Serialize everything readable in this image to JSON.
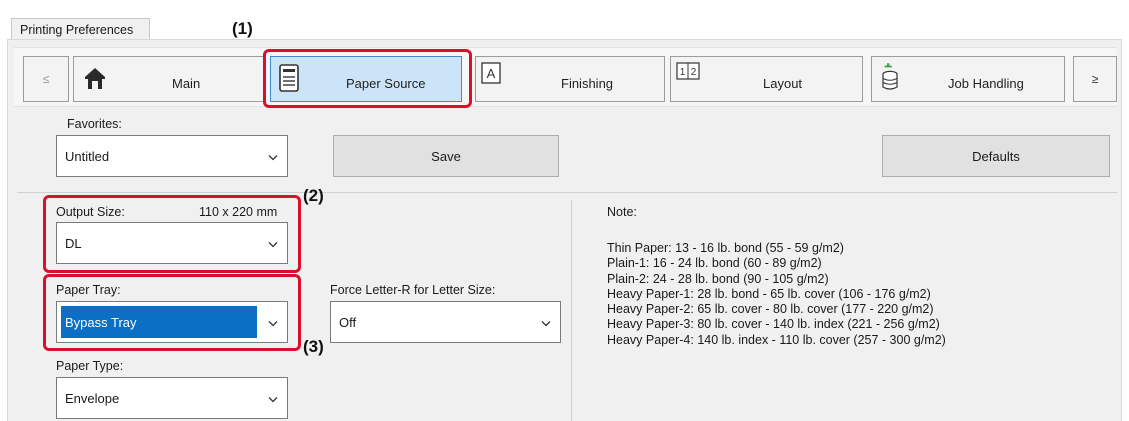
{
  "window": {
    "tab_title": "Printing Preferences"
  },
  "callouts": {
    "c1": "(1)",
    "c2": "(2)",
    "c3": "(3)"
  },
  "toolbar": {
    "prev_label": "≤",
    "next_label": "≥",
    "tabs": [
      {
        "label": "Main",
        "icon": "home-icon"
      },
      {
        "label": "Paper Source",
        "icon": "printer-tray-icon"
      },
      {
        "label": "Finishing",
        "icon": "document-a-icon"
      },
      {
        "label": "Layout",
        "icon": "layout-pages-icon"
      },
      {
        "label": "Job Handling",
        "icon": "stack-icon"
      }
    ]
  },
  "favorites": {
    "label": "Favorites:",
    "value": "Untitled",
    "save_label": "Save",
    "defaults_label": "Defaults"
  },
  "output_size": {
    "label": "Output Size:",
    "dims": "110 x 220 mm",
    "value": "DL"
  },
  "paper_tray": {
    "label": "Paper Tray:",
    "value": "Bypass Tray"
  },
  "force_letter": {
    "label": "Force Letter-R for Letter Size:",
    "value": "Off"
  },
  "paper_type": {
    "label": "Paper Type:",
    "value": "Envelope"
  },
  "note": {
    "title": "Note:",
    "lines": [
      "Thin Paper: 13 - 16 lb. bond (55 - 59 g/m2)",
      "Plain-1: 16 - 24 lb. bond (60 - 89 g/m2)",
      "Plain-2: 24 - 28 lb. bond (90 - 105 g/m2)",
      "Heavy Paper-1: 28 lb. bond - 65 lb. cover (106 - 176 g/m2)",
      "Heavy Paper-2: 65 lb. cover - 80 lb. cover (177 - 220 g/m2)",
      "Heavy Paper-3: 80 lb. cover - 140 lb. index (221 - 256 g/m2)",
      "Heavy Paper-4: 140 lb. index - 110 lb. cover (257 - 300 g/m2)"
    ]
  },
  "colors": {
    "highlight": "#d8102c",
    "selection": "#0b6fc5",
    "active_tab": "#cce4f7"
  }
}
